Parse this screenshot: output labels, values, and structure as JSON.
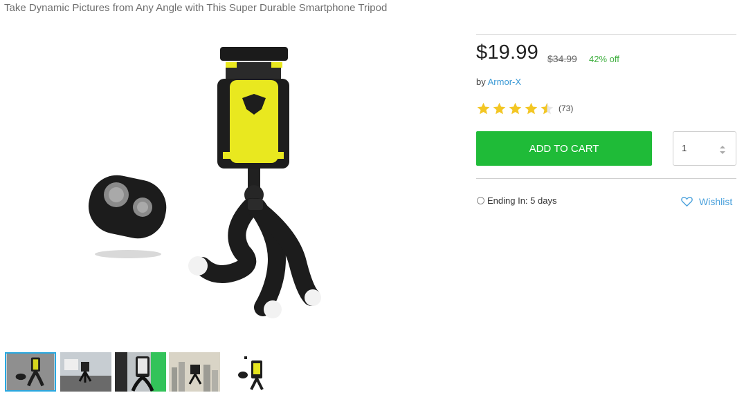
{
  "product": {
    "title": "Take Dynamic Pictures from Any Angle with This Super Durable Smartphone Tripod",
    "main_image_icon": "tripod-product-photo",
    "thumbnails": [
      {
        "icon": "tripod-thumbnail",
        "active": true
      },
      {
        "icon": "tripod-on-railing-thumbnail",
        "active": false
      },
      {
        "icon": "tripod-on-pole-thumbnail",
        "active": false
      },
      {
        "icon": "tripod-cityscape-thumbnail",
        "active": false
      },
      {
        "icon": "tripod-with-remote-thumbnail",
        "active": false
      }
    ]
  },
  "pricing": {
    "price": "$19.99",
    "old_price": "$34.99",
    "discount": "42% off"
  },
  "seller": {
    "by_label": "by",
    "brand": "Armor-X"
  },
  "rating": {
    "stars": 4.5,
    "count_text": "(73)",
    "star_color": "#f3c623"
  },
  "cart": {
    "button_label": "ADD TO CART",
    "button_color": "#1fbb38",
    "quantity": "1"
  },
  "deal": {
    "ending_text": "Ending In: 5 days",
    "wishlist_label": "Wishlist"
  }
}
